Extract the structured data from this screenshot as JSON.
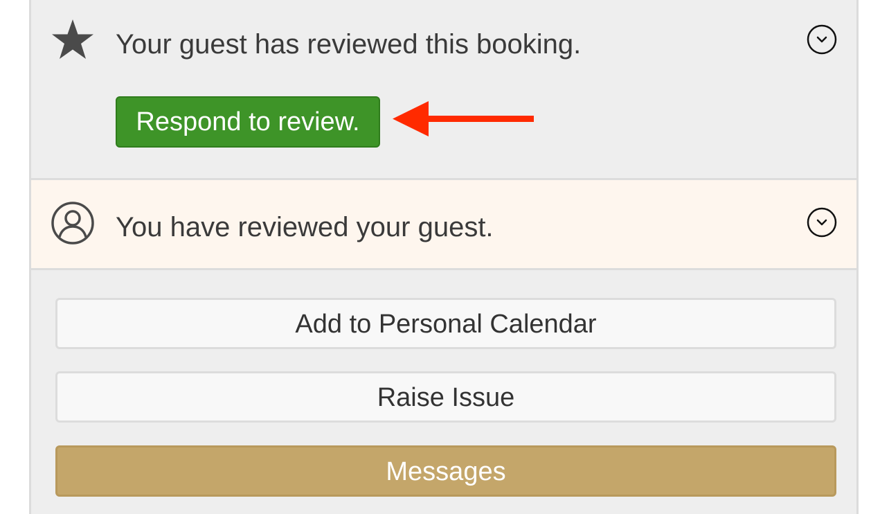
{
  "guest_review": {
    "icon": "star-icon",
    "text": "Your guest has reviewed this booking.",
    "respond_label": "Respond to review.",
    "chevron_icon": "chevron-down-icon"
  },
  "host_review": {
    "icon": "user-circle-icon",
    "text": "You have reviewed your guest.",
    "chevron_icon": "chevron-down-icon"
  },
  "actions": {
    "add_calendar_label": "Add to Personal Calendar",
    "raise_issue_label": "Raise Issue",
    "messages_label": "Messages"
  },
  "colors": {
    "respond_button": "#3e9428",
    "messages_button": "#c4a66a",
    "annotation_arrow": "#ff2a00",
    "host_review_background": "#fef6ee"
  }
}
